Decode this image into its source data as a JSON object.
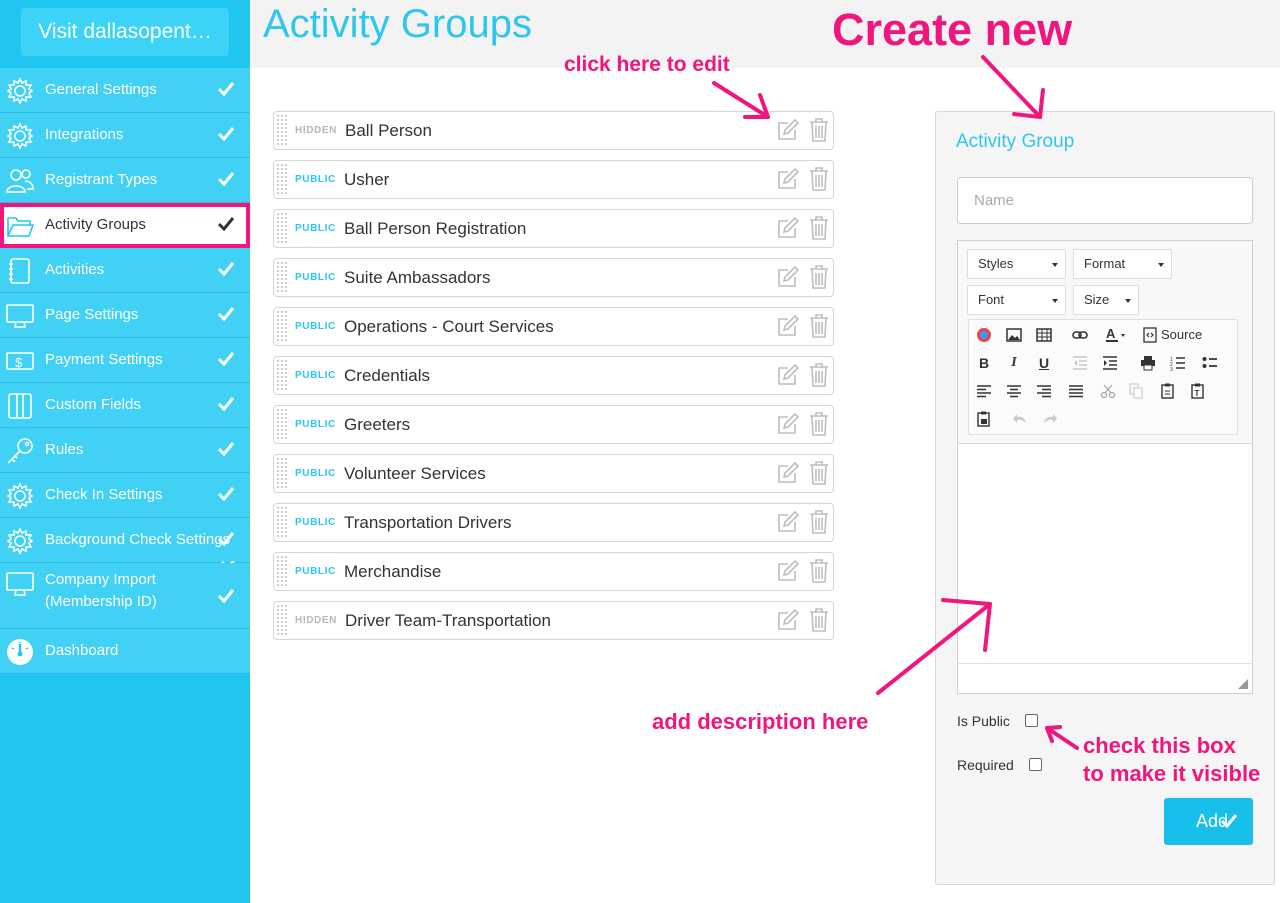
{
  "sidebar": {
    "visit_label": "Visit dallasopent…",
    "items": [
      {
        "label": "General Settings",
        "icon": "gear-icon"
      },
      {
        "label": "Integrations",
        "icon": "gear-icon"
      },
      {
        "label": "Registrant Types",
        "icon": "users-icon"
      },
      {
        "label": "Activity Groups",
        "icon": "folder-icon",
        "active": true
      },
      {
        "label": "Activities",
        "icon": "notebook-icon"
      },
      {
        "label": "Page Settings",
        "icon": "monitor-icon"
      },
      {
        "label": "Payment Settings",
        "icon": "dollar-icon"
      },
      {
        "label": "Custom Fields",
        "icon": "columns-icon"
      },
      {
        "label": "Rules",
        "icon": "key-icon"
      },
      {
        "label": "Check In Settings",
        "icon": "gear-icon"
      },
      {
        "label": "Background Check Settings",
        "icon": "gear-icon"
      },
      {
        "label": "Company Import (Membership ID)",
        "icon": "monitor-icon"
      },
      {
        "label": "Dashboard",
        "icon": "gauge-icon"
      }
    ]
  },
  "page": {
    "title": "Activity Groups"
  },
  "groups": [
    {
      "status": "HIDDEN",
      "name": "Ball Person"
    },
    {
      "status": "PUBLIC",
      "name": "Usher"
    },
    {
      "status": "PUBLIC",
      "name": "Ball Person Registration"
    },
    {
      "status": "PUBLIC",
      "name": "Suite Ambassadors"
    },
    {
      "status": "PUBLIC",
      "name": "Operations - Court Services"
    },
    {
      "status": "PUBLIC",
      "name": "Credentials"
    },
    {
      "status": "PUBLIC",
      "name": "Greeters"
    },
    {
      "status": "PUBLIC",
      "name": "Volunteer Services"
    },
    {
      "status": "PUBLIC",
      "name": "Transportation Drivers"
    },
    {
      "status": "PUBLIC",
      "name": "Merchandise"
    },
    {
      "status": "HIDDEN",
      "name": "Driver Team-Transportation"
    }
  ],
  "form": {
    "title": "Activity Group",
    "name_placeholder": "Name",
    "editor": {
      "styles": "Styles",
      "format": "Format",
      "font": "Font",
      "size": "Size",
      "source": "Source",
      "bold": "B",
      "italic": "I",
      "underline": "U"
    },
    "is_public_label": "Is Public",
    "required_label": "Required",
    "add_label": "Add"
  },
  "annotations": {
    "create_new": "Create new",
    "click_edit": "click here to edit",
    "add_description": "add description here",
    "check_box_line1": "check this box",
    "check_box_line2": "to make it visible"
  },
  "colors": {
    "sidebar": "#21c6f0",
    "accent": "#2bc7ef",
    "annotation": "#f1167e",
    "add_button": "#18bfea"
  }
}
